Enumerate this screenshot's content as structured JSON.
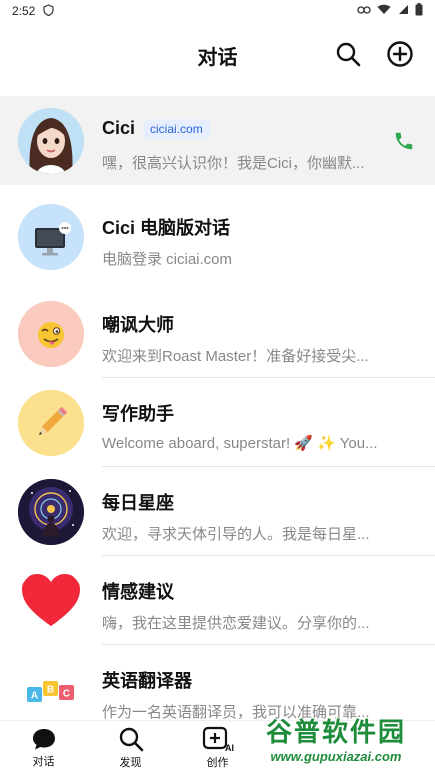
{
  "status_bar": {
    "time": "2:52"
  },
  "header": {
    "title": "对话"
  },
  "conversations": [
    {
      "name": "Cici",
      "badge": "ciciai.com",
      "preview": "嘿，很高兴认识你！我是Cici，你幽默..."
    },
    {
      "name": "Cici 电脑版对话",
      "preview": "电脑登录 ciciai.com"
    },
    {
      "name": "嘲讽大师",
      "preview": "欢迎来到Roast Master！准备好接受尖..."
    },
    {
      "name": "写作助手",
      "preview": "Welcome aboard, superstar! 🚀 ✨ You..."
    },
    {
      "name": "每日星座",
      "preview": "欢迎，寻求天体引导的人。我是每日星..."
    },
    {
      "name": "情感建议",
      "preview": "嗨，我在这里提供恋爱建议。分享你的..."
    },
    {
      "name": "英语翻译器",
      "preview": "作为一名英语翻译员，我可以准确可靠..."
    }
  ],
  "bottom_nav": [
    {
      "label": "对话",
      "icon": "chat-icon"
    },
    {
      "label": "发现",
      "icon": "search-icon"
    },
    {
      "label": "创作",
      "icon": "create-ai-icon"
    }
  ],
  "watermark": {
    "title": "谷普软件园",
    "url": "www.gupuxiazai.com"
  },
  "colors": {
    "accent": "#2a63d6",
    "phone": "#2fa84f",
    "active_row": "#f2f2f2"
  }
}
